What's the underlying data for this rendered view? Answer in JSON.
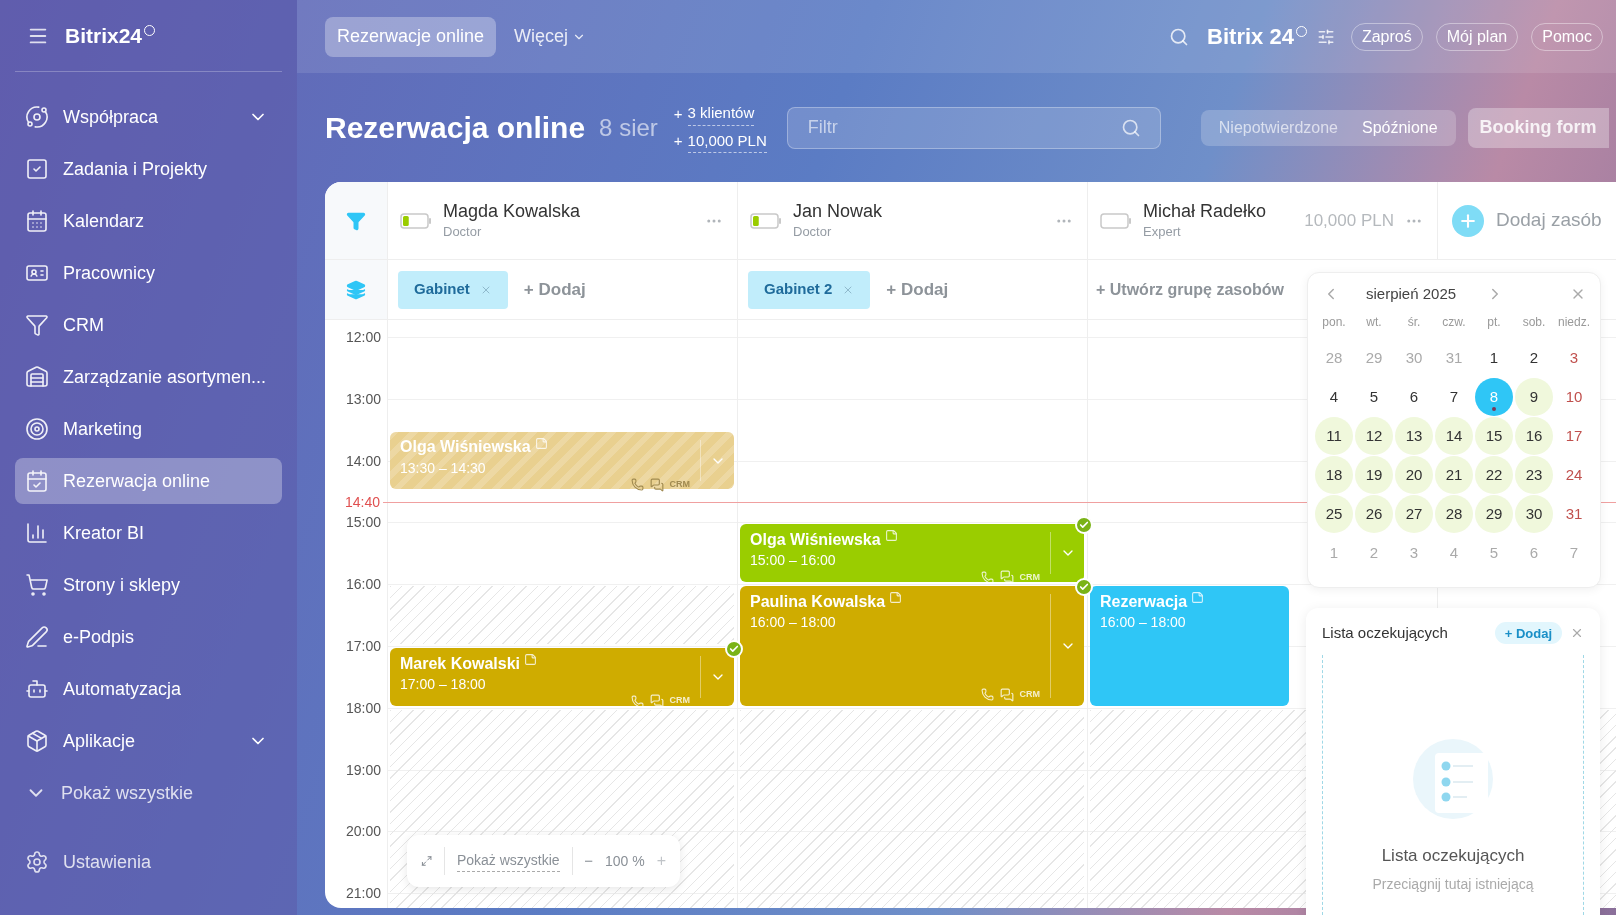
{
  "topbar": {
    "logo": "Bitrix24",
    "tabs": [
      {
        "label": "Rezerwacje online",
        "selected": true
      },
      {
        "label": "Więcej",
        "selected": false
      }
    ],
    "brand": "Bitrix 24",
    "buttons": [
      "Zaproś",
      "Mój plan",
      "Pomoc"
    ]
  },
  "sidebar": {
    "items": [
      {
        "label": "Współpraca",
        "kind": "group",
        "selected": false
      },
      {
        "label": "Zadania i Projekty",
        "kind": "link",
        "selected": false
      },
      {
        "label": "Kalendarz",
        "kind": "link",
        "selected": false
      },
      {
        "label": "Pracownicy",
        "kind": "link",
        "selected": false
      },
      {
        "label": "CRM",
        "kind": "link",
        "selected": false
      },
      {
        "label": "Zarządzanie asortymen...",
        "kind": "link",
        "selected": false
      },
      {
        "label": "Marketing",
        "kind": "link",
        "selected": false
      },
      {
        "label": "Rezerwacja online",
        "kind": "link",
        "selected": true
      },
      {
        "label": "Kreator BI",
        "kind": "link",
        "selected": false
      },
      {
        "label": "Strony i sklepy",
        "kind": "link",
        "selected": false
      },
      {
        "label": "e-Podpis",
        "kind": "link",
        "selected": false
      },
      {
        "label": "Automatyzacja",
        "kind": "link",
        "selected": false
      },
      {
        "label": "Aplikacje",
        "kind": "group",
        "selected": false
      },
      {
        "label": "Pokaż wszystkie",
        "kind": "more",
        "selected": false
      }
    ],
    "settings": "Ustawienia"
  },
  "header": {
    "title": "Rezerwacja online",
    "date": "8 sier",
    "stats": [
      {
        "prefix": "+",
        "value": "3 klientów"
      },
      {
        "prefix": "+",
        "value": "10,000 PLN"
      }
    ],
    "filter": {
      "placeholder": "Filtr"
    },
    "segments": [
      {
        "label": "Niepotwierdzone",
        "selected": false
      },
      {
        "label": "Spóźnione",
        "selected": true
      }
    ],
    "booking_button": "Booking form"
  },
  "board": {
    "add_resource": "Dodaj zasób",
    "resources": [
      {
        "name": "Magda Kowalska",
        "role": "Doctor",
        "level": 0.25,
        "group": {
          "chip": "Gabinet",
          "add": "+ Dodaj"
        },
        "events": [
          {
            "name": "Olga Wiśniewska",
            "time": "13:30 – 14:30",
            "color": "#e9d08f",
            "past": true,
            "confirmed": false,
            "crm": "CRM"
          },
          {
            "name": "Marek Kowalski",
            "time": "17:00 – 18:00",
            "color": "#cfac00",
            "past": false,
            "confirmed": true,
            "crm": "CRM"
          }
        ]
      },
      {
        "name": "Jan Nowak",
        "role": "Doctor",
        "level": 0.25,
        "group": {
          "chip": "Gabinet 2",
          "add": "+ Dodaj"
        },
        "events": [
          {
            "name": "Olga Wiśniewska",
            "time": "15:00 – 16:00",
            "color": "#9acd00",
            "past": false,
            "confirmed": true,
            "crm": "CRM"
          },
          {
            "name": "Paulina Kowalska",
            "time": "16:00 – 18:00",
            "color": "#cfac00",
            "past": false,
            "confirmed": true,
            "crm": "CRM"
          }
        ]
      },
      {
        "name": "Michał Radełko",
        "role": "Expert",
        "level": 0,
        "amount": "10,000 PLN",
        "group": {
          "create": "+ Utwórz grupę zasobów"
        },
        "events": [
          {
            "name": "Rezerwacja",
            "time": "16:00 – 18:00",
            "color": "#2fc6f6",
            "past": false,
            "confirmed": false
          }
        ]
      }
    ],
    "hours": [
      "12:00",
      "13:00",
      "14:00",
      "15:00",
      "16:00",
      "17:00",
      "18:00",
      "19:00",
      "20:00",
      "21:00"
    ],
    "now": "14:40",
    "zoom": {
      "show_all": "Pokaż wszystkie",
      "minus": "−",
      "value": "100 %",
      "plus": "+"
    }
  },
  "calendar": {
    "month": "sierpień 2025",
    "weekdays": [
      "pon.",
      "wt.",
      "śr.",
      "czw.",
      "pt.",
      "sob.",
      "niedz."
    ],
    "weeks": [
      [
        {
          "d": "28",
          "kind": "out",
          "available": false,
          "selected": false
        },
        {
          "d": "29",
          "kind": "out",
          "available": false,
          "selected": false
        },
        {
          "d": "30",
          "kind": "out",
          "available": false,
          "selected": false
        },
        {
          "d": "31",
          "kind": "out",
          "available": false,
          "selected": false
        },
        {
          "d": "1",
          "kind": "day",
          "available": false,
          "selected": false
        },
        {
          "d": "2",
          "kind": "day",
          "available": false,
          "selected": false
        },
        {
          "d": "3",
          "kind": "sun",
          "available": false,
          "selected": false
        }
      ],
      [
        {
          "d": "4",
          "kind": "day",
          "available": false,
          "selected": false
        },
        {
          "d": "5",
          "kind": "day",
          "available": false,
          "selected": false
        },
        {
          "d": "6",
          "kind": "day",
          "available": false,
          "selected": false
        },
        {
          "d": "7",
          "kind": "day",
          "available": false,
          "selected": false
        },
        {
          "d": "8",
          "kind": "day",
          "available": false,
          "selected": true,
          "dot": true
        },
        {
          "d": "9",
          "kind": "day",
          "available": true,
          "selected": false
        },
        {
          "d": "10",
          "kind": "sun",
          "available": false,
          "selected": false
        }
      ],
      [
        {
          "d": "11",
          "kind": "day",
          "available": true,
          "selected": false
        },
        {
          "d": "12",
          "kind": "day",
          "available": true,
          "selected": false
        },
        {
          "d": "13",
          "kind": "day",
          "available": true,
          "selected": false
        },
        {
          "d": "14",
          "kind": "day",
          "available": true,
          "selected": false
        },
        {
          "d": "15",
          "kind": "day",
          "available": true,
          "selected": false
        },
        {
          "d": "16",
          "kind": "day",
          "available": true,
          "selected": false
        },
        {
          "d": "17",
          "kind": "sun",
          "available": false,
          "selected": false
        }
      ],
      [
        {
          "d": "18",
          "kind": "day",
          "available": true,
          "selected": false
        },
        {
          "d": "19",
          "kind": "day",
          "available": true,
          "selected": false
        },
        {
          "d": "20",
          "kind": "day",
          "available": true,
          "selected": false
        },
        {
          "d": "21",
          "kind": "day",
          "available": true,
          "selected": false
        },
        {
          "d": "22",
          "kind": "day",
          "available": true,
          "selected": false
        },
        {
          "d": "23",
          "kind": "day",
          "available": true,
          "selected": false
        },
        {
          "d": "24",
          "kind": "sun",
          "available": false,
          "selected": false
        }
      ],
      [
        {
          "d": "25",
          "kind": "day",
          "available": true,
          "selected": false
        },
        {
          "d": "26",
          "kind": "day",
          "available": true,
          "selected": false
        },
        {
          "d": "27",
          "kind": "day",
          "available": true,
          "selected": false
        },
        {
          "d": "28",
          "kind": "day",
          "available": true,
          "selected": false
        },
        {
          "d": "29",
          "kind": "day",
          "available": true,
          "selected": false
        },
        {
          "d": "30",
          "kind": "day",
          "available": true,
          "selected": false
        },
        {
          "d": "31",
          "kind": "sun",
          "available": false,
          "selected": false
        }
      ],
      [
        {
          "d": "1",
          "kind": "out",
          "available": false,
          "selected": false
        },
        {
          "d": "2",
          "kind": "out",
          "available": false,
          "selected": false
        },
        {
          "d": "3",
          "kind": "out",
          "available": false,
          "selected": false
        },
        {
          "d": "4",
          "kind": "out",
          "available": false,
          "selected": false
        },
        {
          "d": "5",
          "kind": "out",
          "available": false,
          "selected": false
        },
        {
          "d": "6",
          "kind": "out",
          "available": false,
          "selected": false
        },
        {
          "d": "7",
          "kind": "out",
          "available": false,
          "selected": false
        }
      ]
    ]
  },
  "waiting_list": {
    "title": "Lista oczekujących",
    "add": "+ Dodaj",
    "empty_title": "Lista oczekujących",
    "empty_text": "Przeciągnij tutaj istniejącą"
  }
}
